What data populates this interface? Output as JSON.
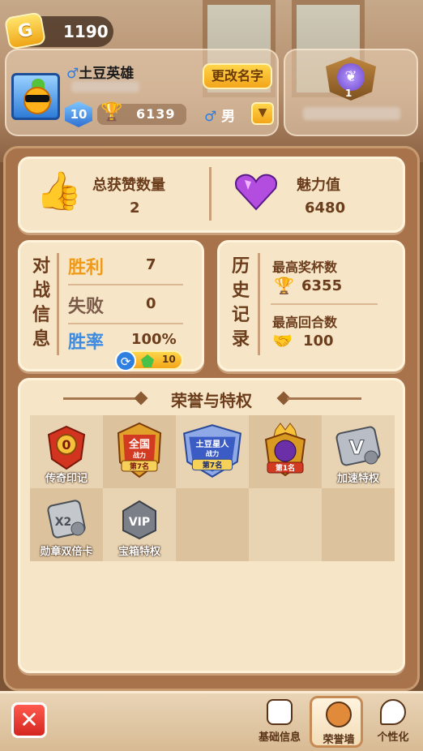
{
  "currency": {
    "amount": "1190",
    "icon": "gold-coin-icon",
    "coin_letter": "G"
  },
  "profile": {
    "name": "土豆英雄",
    "gender_symbol": "♂",
    "rename_label": "更改名字",
    "level": "10",
    "trophies": "6139",
    "gender_label": "男",
    "badge_level": "1"
  },
  "stats": {
    "likes_label": "总获赞数量",
    "likes_value": "2",
    "charm_label": "魅力值",
    "charm_value": "6480"
  },
  "battle": {
    "title_chars": [
      "对",
      "战",
      "信",
      "息"
    ],
    "win_label": "胜利",
    "win_value": "7",
    "lose_label": "失败",
    "lose_value": "0",
    "rate_label": "胜率",
    "rate_value": "100%",
    "reset_cost": "10"
  },
  "history": {
    "title_chars": [
      "历",
      "史",
      "记",
      "录"
    ],
    "max_trophy_label": "最高奖杯数",
    "max_trophy_value": "6355",
    "max_round_label": "最高回合数",
    "max_round_value": "100"
  },
  "honors": {
    "title": "荣誉与特权",
    "items": [
      {
        "label": "传奇印记",
        "icon": "legend-mark-icon",
        "badge_text": "0"
      },
      {
        "label": "",
        "icon": "national-power-badge-icon",
        "line1": "全国",
        "line2": "战力",
        "line3": "第7名"
      },
      {
        "label": "",
        "icon": "potato-star-power-badge-icon",
        "line1": "土豆星人",
        "line2": "战力",
        "line3": "第7名"
      },
      {
        "label": "",
        "icon": "rank-first-badge-icon",
        "line3": "第1名"
      },
      {
        "label": "加速特权",
        "icon": "speed-privilege-icon",
        "badge_text": "V"
      },
      {
        "label": "勋章双倍卡",
        "icon": "double-medal-card-icon",
        "badge_text": "X2"
      },
      {
        "label": "宝箱特权",
        "icon": "vip-chest-icon",
        "badge_text": "VIP"
      }
    ]
  },
  "nav": {
    "close_label": "✕",
    "basic_info": "基础信息",
    "honor_wall": "荣誉墙",
    "personalize": "个性化"
  },
  "colors": {
    "accent": "#f3a51a",
    "win": "#f09a18",
    "lose": "#7a5a48",
    "rate": "#3f8be0"
  }
}
